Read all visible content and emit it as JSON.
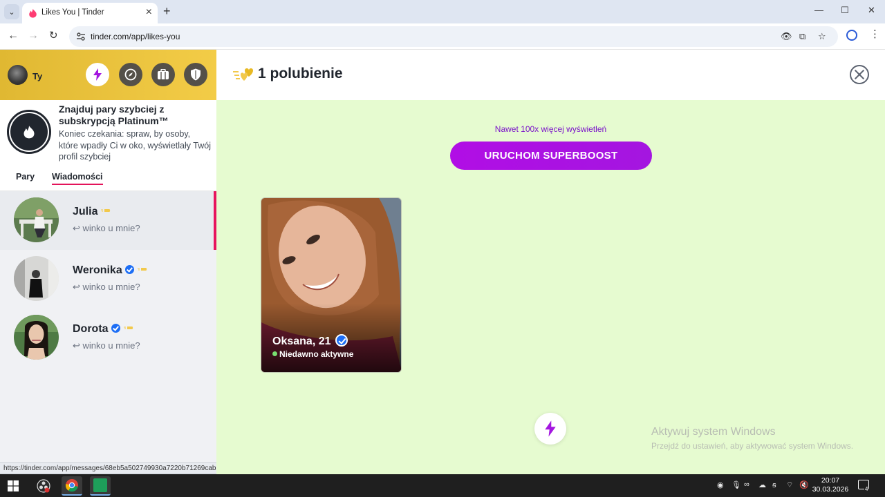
{
  "browser": {
    "tab_title": "Likes You | Tinder",
    "url": "tinder.com/app/likes-you",
    "new_tab_symbol": "+",
    "tab_close_symbol": "×",
    "minimize_symbol": "—",
    "maximize_symbol": "☐",
    "close_symbol": "✕"
  },
  "sidebar": {
    "me_label": "Ty",
    "promo": {
      "title": "Znajduj pary szybciej z subskrypcją Platinum™",
      "text": "Koniec czekania: spraw, by osoby, które wpadły Ci w oko, wyświetlały Twój profil szybciej"
    },
    "tabs": {
      "pairs": "Pary",
      "messages": "Wiadomości"
    },
    "matches": [
      {
        "name": "Julia",
        "verified": false,
        "message": "winko u mnie?"
      },
      {
        "name": "Weronika",
        "verified": true,
        "message": "winko u mnie?"
      },
      {
        "name": "Dorota",
        "verified": true,
        "message": "winko u mnie?"
      }
    ],
    "reply_symbol": "↩"
  },
  "main": {
    "likes_title": "1 polubienie",
    "boost_note": "Nawet 100x więcej wyświetleń",
    "superboost_label": "URUCHOM SUPERBOOST",
    "card": {
      "name": "Oksana, 21",
      "status": "Niedawno aktywne"
    }
  },
  "status_url": "https://tinder.com/app/messages/68eb5a502749930a7220b71269cab356e970144ab0b910f1",
  "watermark": {
    "title": "Aktywuj system Windows",
    "subtitle": "Przejdź do ustawień, aby aktywować system Windows."
  },
  "taskbar": {
    "time": "20:07",
    "date": "30.03.2026",
    "notifications": "4"
  },
  "colors": {
    "brand_gold": "#f3cc47",
    "accent_pink": "#e3145a",
    "superboost_purple": "#a416e0",
    "likes_bg": "#e6fbd0",
    "verified_blue": "#1d6ef5"
  }
}
